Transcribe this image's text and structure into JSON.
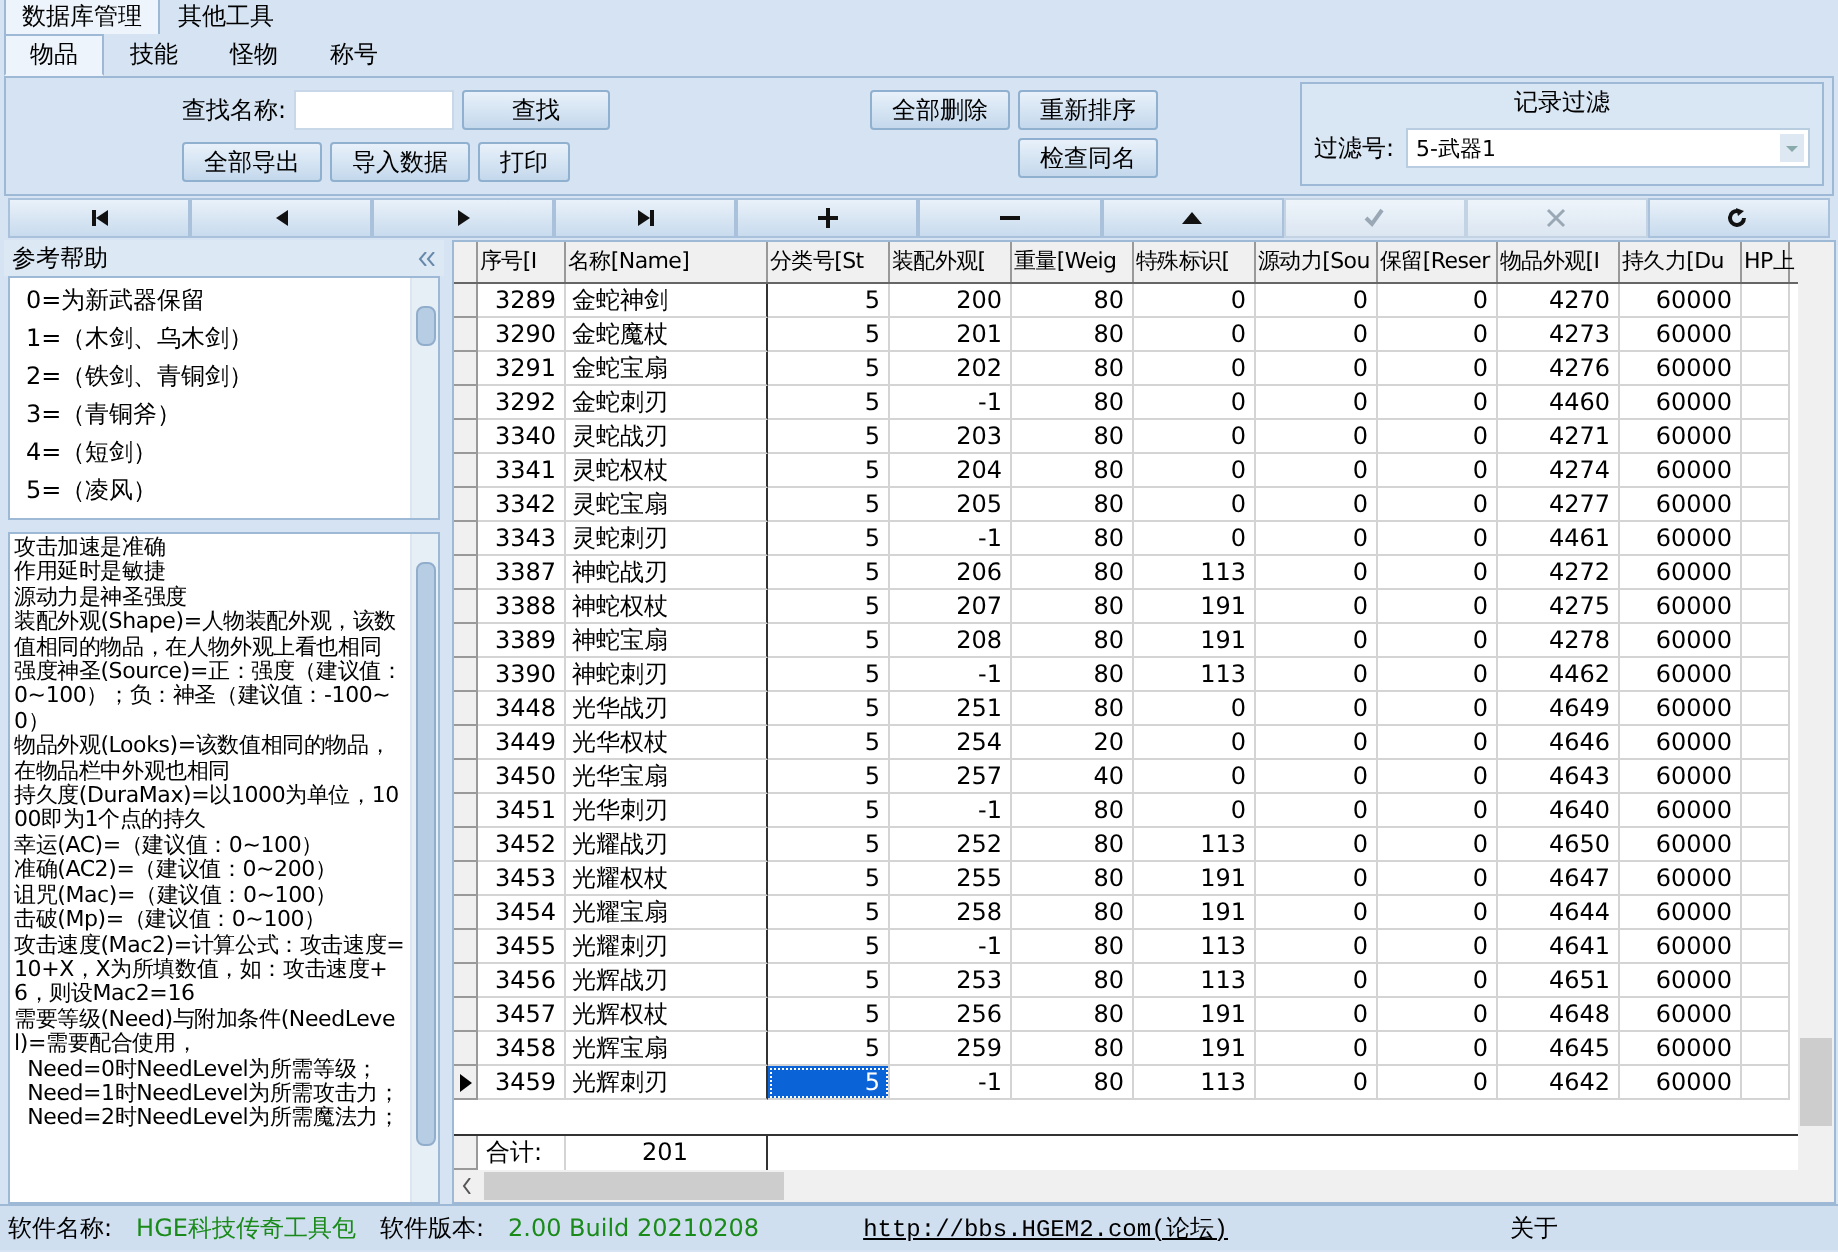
{
  "top_tabs": [
    {
      "label": "数据库管理",
      "selected": true
    },
    {
      "label": "其他工具",
      "selected": false
    }
  ],
  "sub_tabs": [
    {
      "label": "物品",
      "selected": true
    },
    {
      "label": "技能",
      "selected": false
    },
    {
      "label": "怪物",
      "selected": false
    },
    {
      "label": "称号",
      "selected": false
    }
  ],
  "toolbar": {
    "search_label": "查找名称:",
    "find_button": "查找",
    "left_buttons": [
      "全部导出",
      "导入数据",
      "打印"
    ],
    "actions_row1": [
      "全部删除",
      "重新排序"
    ],
    "actions_row2": [
      "检查同名"
    ]
  },
  "filter": {
    "title": "记录过滤",
    "label": "过滤号:",
    "value": "5-武器1"
  },
  "nav": [
    {
      "kind": "first",
      "disabled": false
    },
    {
      "kind": "prior",
      "disabled": false
    },
    {
      "kind": "next",
      "disabled": false
    },
    {
      "kind": "last",
      "disabled": false
    },
    {
      "kind": "insert",
      "disabled": false
    },
    {
      "kind": "delete",
      "disabled": false
    },
    {
      "kind": "edit",
      "disabled": false
    },
    {
      "kind": "post",
      "disabled": true
    },
    {
      "kind": "cancel",
      "disabled": true
    },
    {
      "kind": "refresh",
      "disabled": false
    }
  ],
  "help": {
    "title": "参考帮助",
    "list": [
      "0=为新武器保留",
      "1=（木剑、乌木剑）",
      "2=（铁剑、青铜剑）",
      "3=（青铜斧）",
      "4=（短剑）",
      "5=（凌风）"
    ],
    "notes": [
      "攻击加速是准确",
      "作用延时是敏捷",
      "源动力是神圣强度",
      "装配外观(Shape)=人物装配外观，该数值相同的物品，在人物外观上看也相同",
      "强度神圣(Source)=正：强度（建议值：0~100）；负：神圣（建议值：-100~0）",
      "物品外观(Looks)=该数值相同的物品，在物品栏中外观也相同",
      "持久度(DuraMax)=以1000为单位，1000即为1个点的持久",
      "幸运(AC)=（建议值：0~100）",
      "准确(AC2)=（建议值：0~200）",
      "诅咒(Mac)=（建议值：0~100）",
      "击破(Mp)=（建议值：0~100）",
      "攻击速度(Mac2)=计算公式：攻击速度=10+X，X为所填数值，如：攻击速度+6，则设Mac2=16",
      "需要等级(Need)与附加条件(NeedLevel)=需要配合使用，",
      "  Need=0时NeedLevel为所需等级；",
      "  Need=1时NeedLevel为所需攻击力；",
      "  Need=2时NeedLevel为所需魔法力；"
    ]
  },
  "table": {
    "columns": [
      "序号[I",
      "名称[Name]",
      "分类号[St",
      "装配外观[",
      "重量[Weig",
      "特殊标识[",
      "源动力[Sou",
      "保留[Reser",
      "物品外观[I",
      "持久力[Du",
      "HP上"
    ],
    "rows": [
      {
        "selected": false,
        "cells": [
          "3289",
          "金蛇神剑",
          "5",
          "200",
          "80",
          "0",
          "0",
          "0",
          "4270",
          "60000"
        ]
      },
      {
        "selected": false,
        "cells": [
          "3290",
          "金蛇魔杖",
          "5",
          "201",
          "80",
          "0",
          "0",
          "0",
          "4273",
          "60000"
        ]
      },
      {
        "selected": false,
        "cells": [
          "3291",
          "金蛇宝扇",
          "5",
          "202",
          "80",
          "0",
          "0",
          "0",
          "4276",
          "60000"
        ]
      },
      {
        "selected": false,
        "cells": [
          "3292",
          "金蛇刺刃",
          "5",
          "-1",
          "80",
          "0",
          "0",
          "0",
          "4460",
          "60000"
        ]
      },
      {
        "selected": false,
        "cells": [
          "3340",
          "灵蛇战刃",
          "5",
          "203",
          "80",
          "0",
          "0",
          "0",
          "4271",
          "60000"
        ]
      },
      {
        "selected": false,
        "cells": [
          "3341",
          "灵蛇权杖",
          "5",
          "204",
          "80",
          "0",
          "0",
          "0",
          "4274",
          "60000"
        ]
      },
      {
        "selected": false,
        "cells": [
          "3342",
          "灵蛇宝扇",
          "5",
          "205",
          "80",
          "0",
          "0",
          "0",
          "4277",
          "60000"
        ]
      },
      {
        "selected": false,
        "cells": [
          "3343",
          "灵蛇刺刃",
          "5",
          "-1",
          "80",
          "0",
          "0",
          "0",
          "4461",
          "60000"
        ]
      },
      {
        "selected": false,
        "cells": [
          "3387",
          "神蛇战刃",
          "5",
          "206",
          "80",
          "113",
          "0",
          "0",
          "4272",
          "60000"
        ]
      },
      {
        "selected": false,
        "cells": [
          "3388",
          "神蛇权杖",
          "5",
          "207",
          "80",
          "191",
          "0",
          "0",
          "4275",
          "60000"
        ]
      },
      {
        "selected": false,
        "cells": [
          "3389",
          "神蛇宝扇",
          "5",
          "208",
          "80",
          "191",
          "0",
          "0",
          "4278",
          "60000"
        ]
      },
      {
        "selected": false,
        "cells": [
          "3390",
          "神蛇刺刃",
          "5",
          "-1",
          "80",
          "113",
          "0",
          "0",
          "4462",
          "60000"
        ]
      },
      {
        "selected": false,
        "cells": [
          "3448",
          "光华战刃",
          "5",
          "251",
          "80",
          "0",
          "0",
          "0",
          "4649",
          "60000"
        ]
      },
      {
        "selected": false,
        "cells": [
          "3449",
          "光华权杖",
          "5",
          "254",
          "20",
          "0",
          "0",
          "0",
          "4646",
          "60000"
        ]
      },
      {
        "selected": false,
        "cells": [
          "3450",
          "光华宝扇",
          "5",
          "257",
          "40",
          "0",
          "0",
          "0",
          "4643",
          "60000"
        ]
      },
      {
        "selected": false,
        "cells": [
          "3451",
          "光华刺刃",
          "5",
          "-1",
          "80",
          "0",
          "0",
          "0",
          "4640",
          "60000"
        ]
      },
      {
        "selected": false,
        "cells": [
          "3452",
          "光耀战刃",
          "5",
          "252",
          "80",
          "113",
          "0",
          "0",
          "4650",
          "60000"
        ]
      },
      {
        "selected": false,
        "cells": [
          "3453",
          "光耀权杖",
          "5",
          "255",
          "80",
          "191",
          "0",
          "0",
          "4647",
          "60000"
        ]
      },
      {
        "selected": false,
        "cells": [
          "3454",
          "光耀宝扇",
          "5",
          "258",
          "80",
          "191",
          "0",
          "0",
          "4644",
          "60000"
        ]
      },
      {
        "selected": false,
        "cells": [
          "3455",
          "光耀刺刃",
          "5",
          "-1",
          "80",
          "113",
          "0",
          "0",
          "4641",
          "60000"
        ]
      },
      {
        "selected": false,
        "cells": [
          "3456",
          "光辉战刃",
          "5",
          "253",
          "80",
          "113",
          "0",
          "0",
          "4651",
          "60000"
        ]
      },
      {
        "selected": false,
        "cells": [
          "3457",
          "光辉权杖",
          "5",
          "256",
          "80",
          "191",
          "0",
          "0",
          "4648",
          "60000"
        ]
      },
      {
        "selected": false,
        "cells": [
          "3458",
          "光辉宝扇",
          "5",
          "259",
          "80",
          "191",
          "0",
          "0",
          "4645",
          "60000"
        ]
      },
      {
        "selected": true,
        "cells": [
          "3459",
          "光辉刺刃",
          "5",
          "-1",
          "80",
          "113",
          "0",
          "0",
          "4642",
          "60000"
        ]
      }
    ],
    "total_label": "合计:",
    "total_value": "201"
  },
  "status_bar": {
    "name_label": "软件名称:",
    "name": "HGE科技传奇工具包",
    "version_label": "软件版本:",
    "version": "2.00 Build 20210208",
    "link": "http://bbs.HGEM2.com(论坛)",
    "about": "关于"
  }
}
